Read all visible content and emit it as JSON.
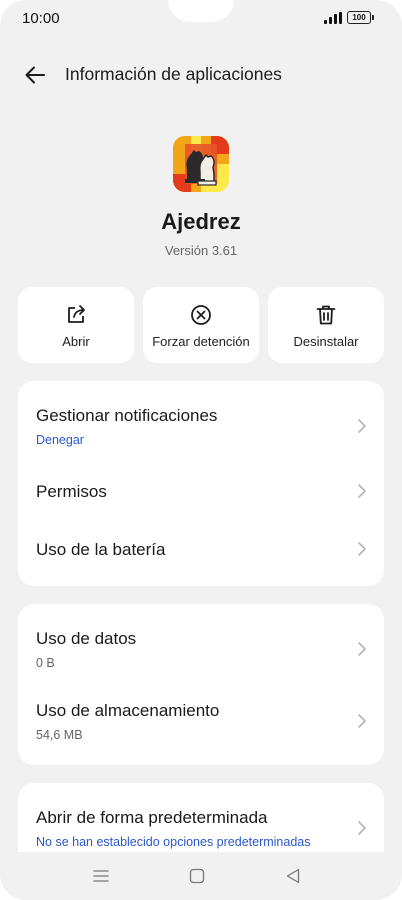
{
  "status_bar": {
    "time": "10:00",
    "battery": "100"
  },
  "header": {
    "title": "Información de aplicaciones",
    "back_icon": "arrow-left-icon"
  },
  "app": {
    "name": "Ajedrez",
    "version": "Versión 3.61",
    "icon": "chess-knights-icon",
    "icon_colors": [
      "#e33b1b",
      "#f3a51a",
      "#fde94a"
    ]
  },
  "actions": [
    {
      "label": "Abrir",
      "icon": "open-external-icon"
    },
    {
      "label": "Forzar detención",
      "icon": "force-stop-icon"
    },
    {
      "label": "Desinstalar",
      "icon": "trash-icon"
    }
  ],
  "card1": {
    "notifications": {
      "title": "Gestionar notificaciones",
      "subtitle": "Denegar"
    },
    "permissions": {
      "title": "Permisos"
    },
    "battery": {
      "title": "Uso de la batería"
    }
  },
  "card2": {
    "data": {
      "title": "Uso de datos",
      "subtitle": "0 B"
    },
    "storage": {
      "title": "Uso de almacenamiento",
      "subtitle": "54,6 MB"
    }
  },
  "card3": {
    "default": {
      "title": "Abrir de forma predeterminada",
      "subtitle": "No se han establecido opciones predeterminadas"
    }
  },
  "nav": {
    "icons": [
      "menu-icon",
      "home-square-icon",
      "back-triangle-icon"
    ]
  },
  "colors": {
    "accent_blue": "#2b57c9",
    "background": "#f1f1f1",
    "card": "#ffffff"
  }
}
